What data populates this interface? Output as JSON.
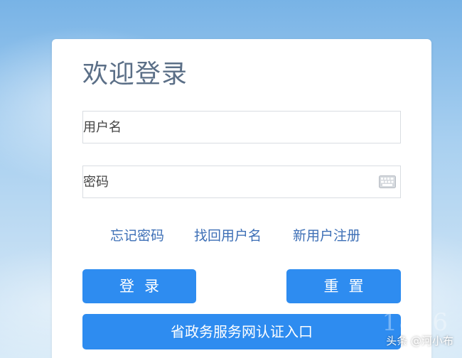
{
  "login": {
    "title": "欢迎登录",
    "username_placeholder": "用户名",
    "password_placeholder": "密码"
  },
  "links": {
    "forgot_password": "忘记密码",
    "recover_username": "找回用户名",
    "register": "新用户注册"
  },
  "buttons": {
    "login": "登录",
    "reset": "重置",
    "gov_auth": "省政务服务网认证入口"
  },
  "watermark": {
    "faint_text": "1876",
    "source": "头条 @河小布"
  },
  "icons": {
    "keyboard": "keyboard-icon"
  },
  "colors": {
    "primary_button": "#2e8cf0",
    "link": "#3d6fb6",
    "title": "#5b6f87"
  }
}
